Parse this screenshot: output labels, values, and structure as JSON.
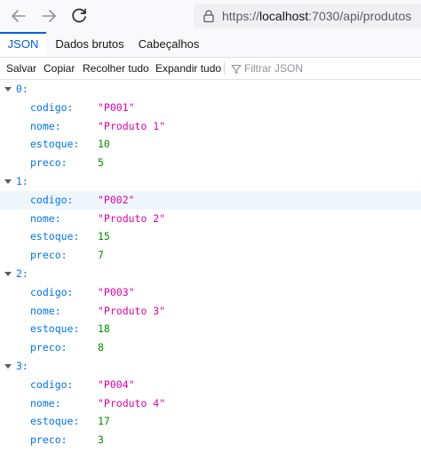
{
  "browser": {
    "url_prefix": "https://",
    "url_host": "localhost",
    "url_rest": ":7030/api/produtos"
  },
  "tabs": [
    {
      "label": "JSON",
      "active": true
    },
    {
      "label": "Dados brutos",
      "active": false
    },
    {
      "label": "Cabeçalhos",
      "active": false
    }
  ],
  "toolbar": {
    "save_label": "Salvar",
    "copy_label": "Copiar",
    "collapse_label": "Recolher tudo",
    "expand_label": "Expandir tudo",
    "filter_placeholder": "Filtrar JSON"
  },
  "items": [
    {
      "index_label": "0:",
      "fields": [
        {
          "key": "codigo:",
          "value": "\"P001\"",
          "type": "string"
        },
        {
          "key": "nome:",
          "value": "\"Produto 1\"",
          "type": "string"
        },
        {
          "key": "estoque:",
          "value": "10",
          "type": "number"
        },
        {
          "key": "preco:",
          "value": "5",
          "type": "number"
        }
      ]
    },
    {
      "index_label": "1:",
      "fields": [
        {
          "key": "codigo:",
          "value": "\"P002\"",
          "type": "string"
        },
        {
          "key": "nome:",
          "value": "\"Produto 2\"",
          "type": "string"
        },
        {
          "key": "estoque:",
          "value": "15",
          "type": "number"
        },
        {
          "key": "preco:",
          "value": "7",
          "type": "number"
        }
      ]
    },
    {
      "index_label": "2:",
      "fields": [
        {
          "key": "codigo:",
          "value": "\"P003\"",
          "type": "string"
        },
        {
          "key": "nome:",
          "value": "\"Produto 3\"",
          "type": "string"
        },
        {
          "key": "estoque:",
          "value": "18",
          "type": "number"
        },
        {
          "key": "preco:",
          "value": "8",
          "type": "number"
        }
      ]
    },
    {
      "index_label": "3:",
      "fields": [
        {
          "key": "codigo:",
          "value": "\"P004\"",
          "type": "string"
        },
        {
          "key": "nome:",
          "value": "\"Produto 4\"",
          "type": "string"
        },
        {
          "key": "estoque:",
          "value": "17",
          "type": "number"
        },
        {
          "key": "preco:",
          "value": "3",
          "type": "number"
        }
      ]
    }
  ],
  "icons": {
    "back": "arrow-left-icon",
    "forward": "arrow-right-icon",
    "reload": "reload-icon",
    "lock": "lock-icon",
    "filter": "filter-icon",
    "twisty": "chevron-down-icon"
  },
  "colors": {
    "accent": "#0061e0",
    "key": "#0074e8",
    "string": "#dd00a9",
    "number": "#058b00",
    "hover_row": "#eff7fd"
  }
}
